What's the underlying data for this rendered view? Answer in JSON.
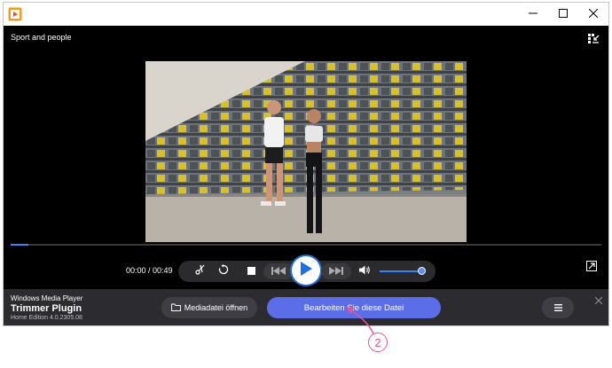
{
  "window": {
    "minimize_icon": "minimize-icon",
    "maximize_icon": "maximize-icon",
    "close_icon": "close-icon"
  },
  "player": {
    "video_title": "Sport and people",
    "time": "00:00 / 00:49",
    "progress_fraction": 0.03,
    "volume_fraction": 0.95
  },
  "bottom": {
    "brand_line1": "Windows Media Player",
    "brand_line2": "Trimmer Plugin",
    "brand_line3": "Home Edition 4.0.2305.08",
    "open_label": "Mediadatei öffnen",
    "edit_label": "Bearbeiten Sie diese Datei"
  },
  "annotation": {
    "number": "2",
    "color": "#e0569c"
  },
  "colors": {
    "accent": "#5b6ee8",
    "progress": "#3b82f6"
  }
}
